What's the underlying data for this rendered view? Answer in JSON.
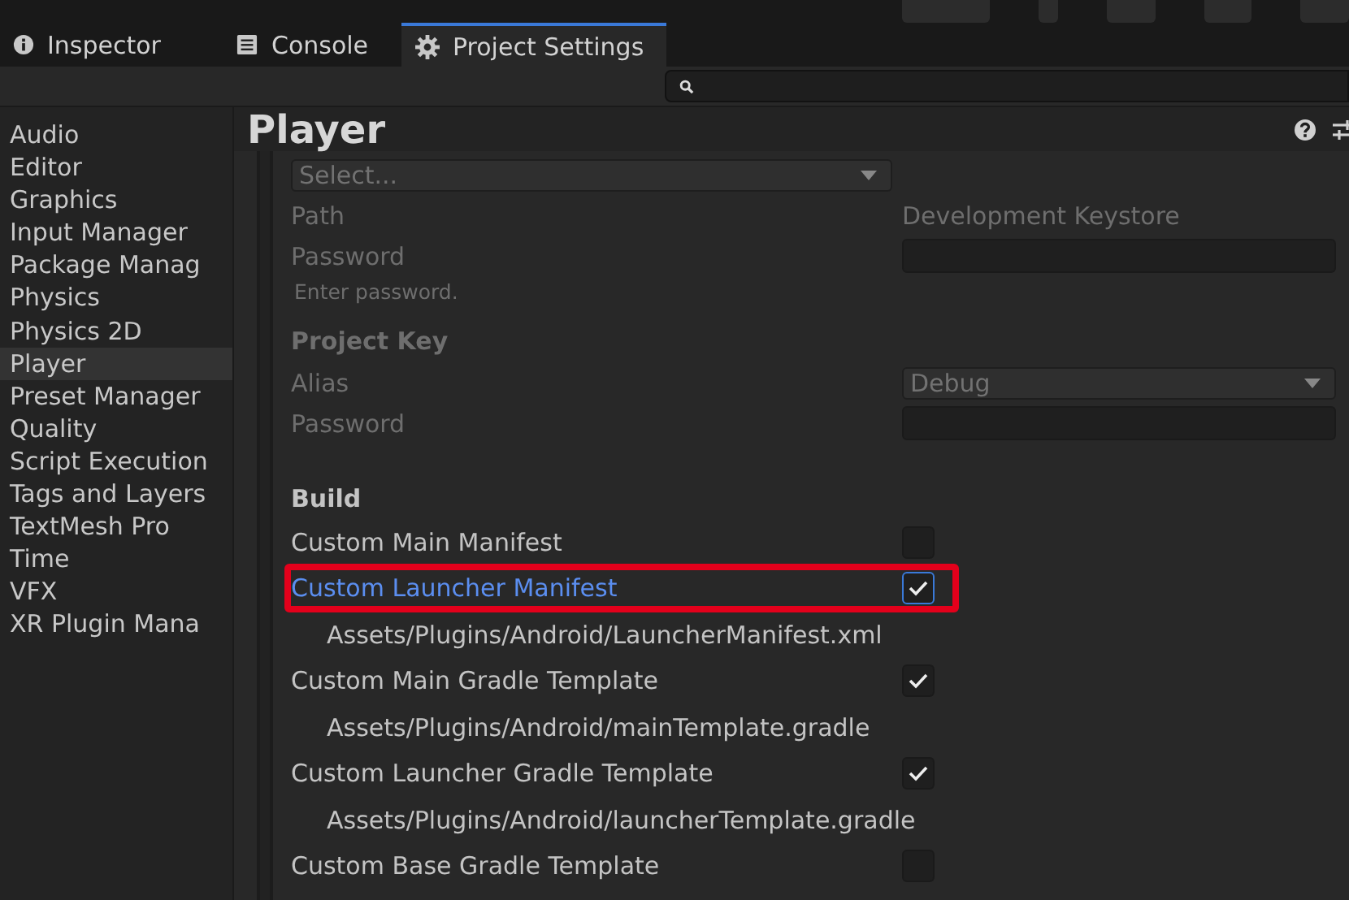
{
  "tabs": [
    {
      "label": "Inspector",
      "kind": "info",
      "selected": false
    },
    {
      "label": "Console",
      "kind": "console",
      "selected": false
    },
    {
      "label": "Project Settings",
      "kind": "gear",
      "selected": true
    }
  ],
  "sidebar": {
    "items": [
      {
        "label": "Audio",
        "selected": false
      },
      {
        "label": "Editor",
        "selected": false
      },
      {
        "label": "Graphics",
        "selected": false
      },
      {
        "label": "Input Manager",
        "selected": false
      },
      {
        "label": "Package Manag",
        "selected": false
      },
      {
        "label": "Physics",
        "selected": false
      },
      {
        "label": "Physics 2D",
        "selected": false
      },
      {
        "label": "Player",
        "selected": true
      },
      {
        "label": "Preset Manager",
        "selected": false
      },
      {
        "label": "Quality",
        "selected": false
      },
      {
        "label": "Script Execution",
        "selected": false
      },
      {
        "label": "Tags and Layers",
        "selected": false
      },
      {
        "label": "TextMesh Pro",
        "selected": false
      },
      {
        "label": "Time",
        "selected": false
      },
      {
        "label": "VFX",
        "selected": false
      },
      {
        "label": "XR Plugin Mana",
        "selected": false
      }
    ]
  },
  "panel": {
    "title": "Player",
    "rows": [
      {
        "kind": "select",
        "value": "Select...",
        "disabled": true
      },
      {
        "kind": "text",
        "label": "Path",
        "value": "Development Keystore",
        "disabled": true
      },
      {
        "kind": "input",
        "label": "Password",
        "disabled": true
      },
      {
        "kind": "hint",
        "text": "Enter password.",
        "disabled": true
      },
      {
        "kind": "heading",
        "text": "Project Key",
        "disabled": true
      },
      {
        "kind": "dropdown",
        "label": "Alias",
        "value": "Debug",
        "disabled": true
      },
      {
        "kind": "input",
        "label": "Password",
        "disabled": true
      },
      {
        "kind": "heading",
        "text": "Build",
        "disabled": false
      },
      {
        "kind": "checkbox",
        "label": "Custom Main Manifest",
        "checked": false,
        "highlighted": false
      },
      {
        "kind": "checkbox",
        "label": "Custom Launcher Manifest",
        "checked": true,
        "highlighted": true
      },
      {
        "kind": "path",
        "text": "Assets/Plugins/Android/LauncherManifest.xml"
      },
      {
        "kind": "checkbox",
        "label": "Custom Main Gradle Template",
        "checked": true,
        "highlighted": false
      },
      {
        "kind": "path",
        "text": "Assets/Plugins/Android/mainTemplate.gradle"
      },
      {
        "kind": "checkbox",
        "label": "Custom Launcher Gradle Template",
        "checked": true,
        "highlighted": false
      },
      {
        "kind": "path",
        "text": "Assets/Plugins/Android/launcherTemplate.gradle"
      },
      {
        "kind": "checkbox",
        "label": "Custom Base Gradle Template",
        "checked": false,
        "highlighted": false
      }
    ]
  }
}
